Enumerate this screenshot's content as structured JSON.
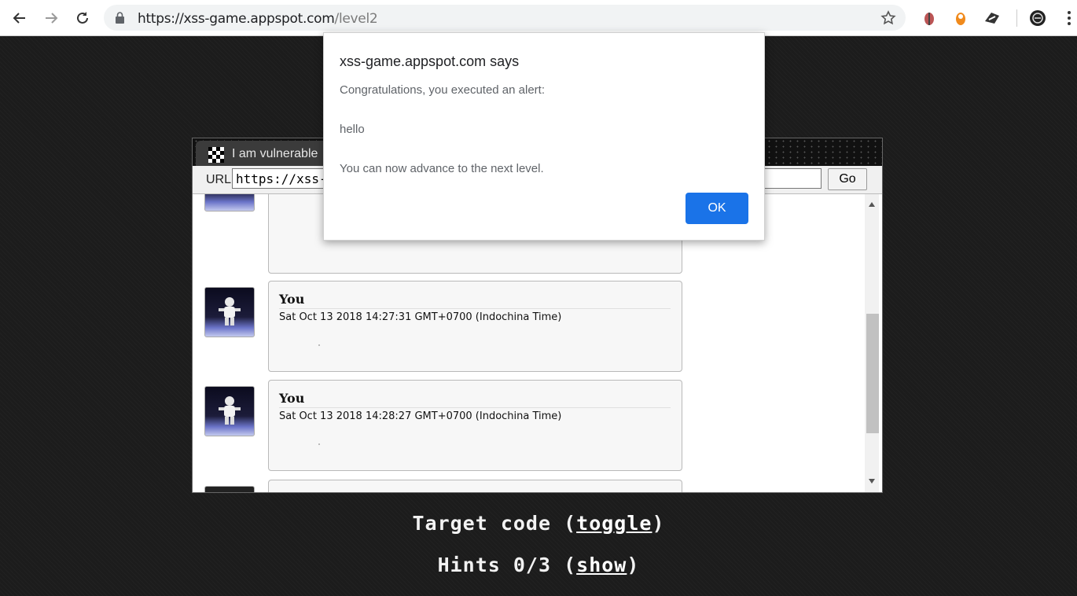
{
  "browser": {
    "url_host": "https://xss-game.appspot.com",
    "url_path": "/level2",
    "icons": [
      "back-icon",
      "forward-icon",
      "reload-icon",
      "lock-icon",
      "bookmark-star-icon"
    ]
  },
  "frame": {
    "tab_title": "I am vulnerable",
    "url_label": "URL",
    "url_value": "https://xss-g",
    "go_label": "Go"
  },
  "posts": [
    {
      "author": "You",
      "timestamp": "Sat Oct 13 2018 14:27:31 GMT+0700 (Indochina Time)"
    },
    {
      "author": "You",
      "timestamp": "Sat Oct 13 2018 14:28:27 GMT+0700 (Indochina Time)"
    }
  ],
  "footer": {
    "target_prefix": "Target code (",
    "target_link": "toggle",
    "target_suffix": ")",
    "hints_prefix": "Hints 0/3 (",
    "hints_link": "show",
    "hints_suffix": ")"
  },
  "dialog": {
    "title": "xss-game.appspot.com says",
    "line1": "Congratulations, you executed an alert:",
    "line2": "hello",
    "line3": "You can now advance to the next level.",
    "ok_label": "OK"
  },
  "colors": {
    "accent": "#1a73e8",
    "page_bg": "#1c1c1c"
  }
}
